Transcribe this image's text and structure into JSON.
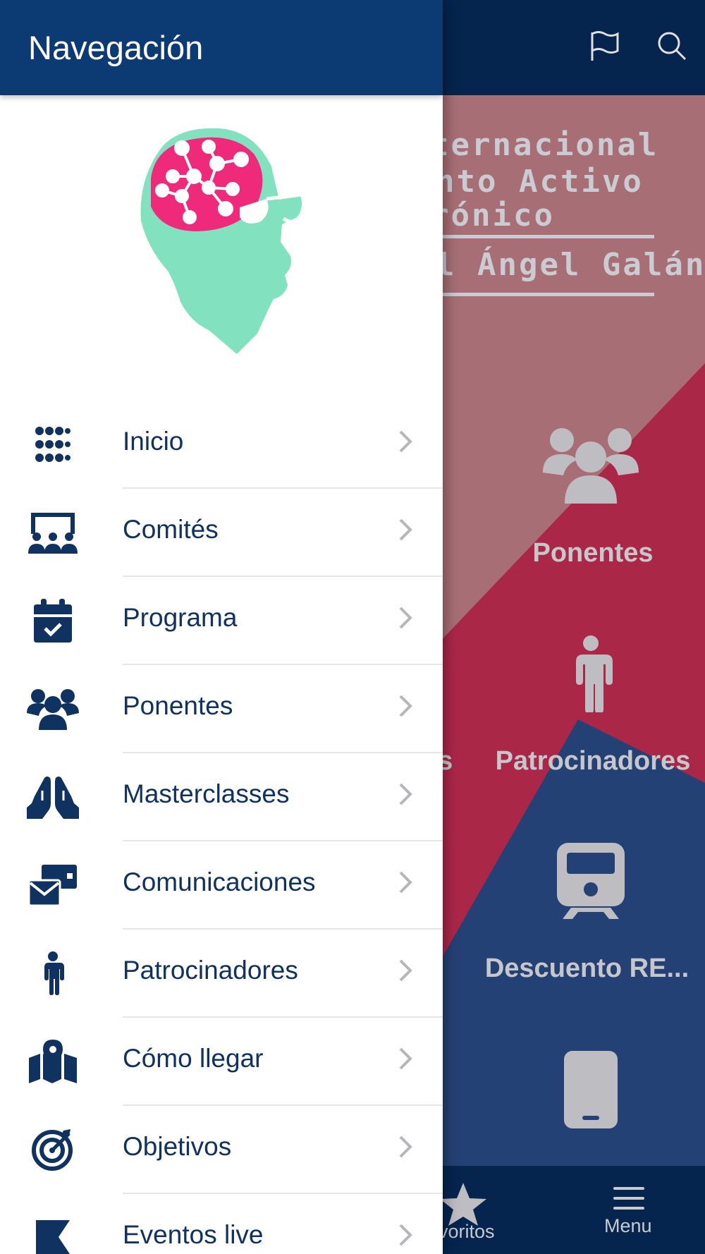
{
  "drawer": {
    "title": "Navegación",
    "items": [
      {
        "label": "Inicio",
        "icon": "grid-icon"
      },
      {
        "label": "Comités",
        "icon": "presentation-audience-icon"
      },
      {
        "label": "Programa",
        "icon": "calendar-check-icon"
      },
      {
        "label": "Ponentes",
        "icon": "users-icon"
      },
      {
        "label": "Masterclasses",
        "icon": "praying-hands-icon"
      },
      {
        "label": "Comunicaciones",
        "icon": "mail-bulk-icon"
      },
      {
        "label": "Patrocinadores",
        "icon": "person-icon"
      },
      {
        "label": "Cómo llegar",
        "icon": "map-location-icon"
      },
      {
        "label": "Objetivos",
        "icon": "target-arrow-icon"
      },
      {
        "label": "Eventos live",
        "icon": "flag-icon"
      }
    ]
  },
  "background": {
    "header_icons": [
      "flag-outline-icon",
      "search-icon"
    ],
    "banner_lines": [
      "ternacional",
      "nto Activo",
      "rónico",
      "l Ángel Galán"
    ],
    "tiles": [
      {
        "label": "Ponentes",
        "icon": "users-icon"
      },
      {
        "label": "es",
        "icon": ""
      },
      {
        "label": "Patrocinadores",
        "icon": "person-icon"
      },
      {
        "label": "Descuento RE...",
        "icon": "train-icon"
      },
      {
        "label": "",
        "icon": "mobile-phone-icon"
      }
    ],
    "tabbar": {
      "favorites_label": "voritos",
      "menu_label": "Menu"
    }
  },
  "colors": {
    "header": "#0c3a72",
    "text_primary": "#0f3261",
    "logo_head": "#82e2bf",
    "logo_brain": "#ef2a7b",
    "banner_pink": "#c07e87",
    "banner_red": "#c22d52",
    "banner_blue": "#2a4b86"
  }
}
